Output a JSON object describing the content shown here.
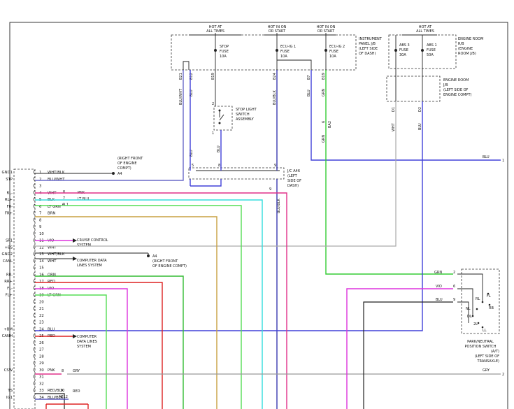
{
  "sources": {
    "hot_at_all_times": [
      "HOT AT",
      "ALL TIMES"
    ],
    "hot_in_on_start": [
      "HOT IN ON",
      "OR START"
    ],
    "hot_in_on_start_2": [
      "HOT IN ON",
      "OR START"
    ],
    "hot_at_all_times_2": [
      "HOT AT",
      "ALL TIMES"
    ]
  },
  "fuses": {
    "stop": [
      "STOP",
      "FUSE",
      "10A"
    ],
    "ecu_ig1": [
      "ECU-IG 1",
      "FUSE",
      "10A"
    ],
    "ecu_ig2": [
      "ECU-IG 2",
      "FUSE",
      "10A"
    ],
    "abs3": [
      "ABS 3",
      "FUSE",
      "30A"
    ],
    "abs1": [
      "ABS 1",
      "FUSE",
      "50A"
    ]
  },
  "blocks": {
    "instrument_panel": [
      "INSTRUMENT",
      "PANEL J/B",
      "(LEFT SIDE",
      "OF DASH)"
    ],
    "engine_room_rb": [
      "ENGINE ROOM",
      "R/B",
      "(ENGINE",
      "ROOM J/B)"
    ],
    "engine_room_jb": [
      "ENGINE ROOM",
      "J/B",
      "(LEFT SIDE OF",
      "ENGINE COMPT)"
    ],
    "stop_light": [
      "STOP LIGHT",
      "SWITCH",
      "ASSEMBLY"
    ],
    "jc_a46": [
      "J/C A46",
      "(LEFT",
      "SIDE OF",
      "DASH)"
    ],
    "right_front_1": [
      "(RIGHT FRONT",
      "OF ENGINE",
      "COMPT)"
    ],
    "a4_1": "A4",
    "a4_2": "A4",
    "right_front_2": [
      "(RIGHT FRONT",
      "OF ENGINE COMPT)"
    ],
    "park_neutral": [
      "PARK/NEUTRAL",
      "POSITION SWITCH",
      "(A/T)",
      "(LEFT SIDE OF",
      "TRANSAXLE)"
    ],
    "park_contacts": [
      "FL",
      "RL",
      "RB",
      "NL",
      "DL",
      "2L",
      "LL"
    ]
  },
  "pin_labels": {
    "b21": "B21",
    "b12": "B12",
    "b19": "B19",
    "b24": "B24",
    "b7": "B7",
    "b19b": "B19",
    "d1": "D1",
    "d2": "D2",
    "a2": "2",
    "a1": "1",
    "ba2": "BA2",
    "b6": "6"
  },
  "wire_labels": {
    "blu_wht": "BLU/WHT",
    "blu_1": "BLU",
    "blu_blk": "BLU/BLK",
    "blu_2": "BLU",
    "grn_1": "GRN",
    "wht_1": "WHT",
    "blu_3": "BLU",
    "blu_4": "BLU",
    "blu_5": "BLU",
    "grn_2": "GRN",
    "blu_blk_2": "BLU/BLK",
    "blu_right": "BLU",
    "grn_r": "GRN",
    "vio_r": "VIO",
    "blu_r": "BLU",
    "gry_r": "GRY",
    "pnk_8": "PNK",
    "ltblu_7": "LT BLU",
    "al1": "AL1",
    "gry_s": "GRY",
    "red_s": "RED",
    "ae12": "AE12"
  },
  "wire_nums": {
    "n5": "5",
    "n8": "8",
    "n9": "9",
    "n8b": "8",
    "n7b": "7",
    "g2": "2",
    "v6": "6",
    "b9": "9",
    "s8": "8",
    "s10": "10",
    "right1": "1",
    "right2": "2"
  },
  "connector": {
    "names": [
      {
        "row": 1,
        "text": "GND1"
      },
      {
        "row": 2,
        "text": "STP"
      },
      {
        "row": 4,
        "text": "RL-"
      },
      {
        "row": 5,
        "text": "RL+"
      },
      {
        "row": 6,
        "text": "FR-"
      },
      {
        "row": 7,
        "text": "FR+"
      },
      {
        "row": 11,
        "text": "SP1"
      },
      {
        "row": 12,
        "text": "+BS"
      },
      {
        "row": 13,
        "text": "GND2"
      },
      {
        "row": 14,
        "text": "CANL"
      },
      {
        "row": 16,
        "text": "RR-"
      },
      {
        "row": 17,
        "text": "RR+"
      },
      {
        "row": 18,
        "text": "FL-"
      },
      {
        "row": 19,
        "text": "FL+"
      },
      {
        "row": 24,
        "text": "+BM"
      },
      {
        "row": 25,
        "text": "CANH"
      },
      {
        "row": 30,
        "text": "CSW"
      },
      {
        "row": 33,
        "text": "TS"
      },
      {
        "row": 34,
        "text": "IG1"
      }
    ],
    "pins": [
      {
        "row": 1,
        "color": "WHT/BLK"
      },
      {
        "row": 2,
        "color": "BLU/WHT"
      },
      {
        "row": 3,
        "color": ""
      },
      {
        "row": 4,
        "color": "WHT"
      },
      {
        "row": 5,
        "color": "BLK"
      },
      {
        "row": 6,
        "color": "LT GRN"
      },
      {
        "row": 7,
        "color": "BRN"
      },
      {
        "row": 8,
        "color": ""
      },
      {
        "row": 9,
        "color": ""
      },
      {
        "row": 10,
        "color": ""
      },
      {
        "row": 11,
        "color": "VIO"
      },
      {
        "row": 12,
        "color": "WHT"
      },
      {
        "row": 13,
        "color": "WHT/BLK"
      },
      {
        "row": 14,
        "color": "WHT"
      },
      {
        "row": 15,
        "color": ""
      },
      {
        "row": 16,
        "color": "ORN"
      },
      {
        "row": 17,
        "color": "RED"
      },
      {
        "row": 18,
        "color": "VIO"
      },
      {
        "row": 19,
        "color": "LT GRN"
      },
      {
        "row": 20,
        "color": ""
      },
      {
        "row": 21,
        "color": ""
      },
      {
        "row": 22,
        "color": ""
      },
      {
        "row": 23,
        "color": ""
      },
      {
        "row": 24,
        "color": "BLU"
      },
      {
        "row": 25,
        "color": "RED"
      },
      {
        "row": 26,
        "color": ""
      },
      {
        "row": 27,
        "color": ""
      },
      {
        "row": 28,
        "color": ""
      },
      {
        "row": 29,
        "color": ""
      },
      {
        "row": 30,
        "color": "PNK"
      },
      {
        "row": 31,
        "color": ""
      },
      {
        "row": 32,
        "color": ""
      },
      {
        "row": 33,
        "color": "RED/BLK"
      },
      {
        "row": 34,
        "color": "BLU/BLK"
      }
    ]
  },
  "systems": {
    "cruise": [
      "CRUISE CONTROL",
      "SYSTEM"
    ],
    "data_lines_1": [
      "COMPUTER DATA",
      "LINES SYSTEM"
    ],
    "data_lines_2": [
      "COMPUTER",
      "DATA LINES",
      "SYSTEM"
    ]
  },
  "colors": {
    "blu": "#4040d8",
    "grn": "#33cc33",
    "pnk": "#e0308a",
    "ltblu": "#33dddd",
    "brn": "#c8a040",
    "vio": "#dd33dd",
    "orn": "#33bb33",
    "red": "#dd2222",
    "ltgrn": "#55dd55",
    "gry": "#999999",
    "blk": "#222222",
    "bluwht": "#6a6ac8",
    "blublk": "#3a3ab0"
  }
}
